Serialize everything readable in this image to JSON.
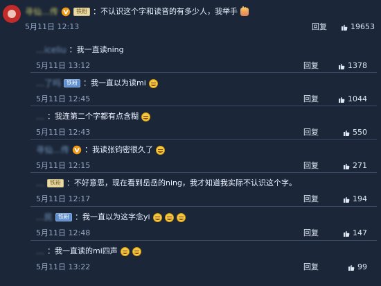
{
  "top_comment": {
    "username": "寻仙…传",
    "fan_label": "铁粉",
    "text": "：不认识这个字和读音的有多少人，我举手",
    "date": "5月11日 12:13",
    "reply_label": "回复",
    "likes": "19653"
  },
  "replies": [
    {
      "username": "…iceliu",
      "fan_label": "",
      "text": "：我一直读ning",
      "date": "5月11日 13:12",
      "reply_label": "回复",
      "likes": "1378",
      "emoji_count": 0
    },
    {
      "username": "…了吗",
      "fan_label": "铁粉",
      "text": "：我一直以为读mi",
      "date": "5月11日 12:45",
      "reply_label": "回复",
      "likes": "1044",
      "emoji_count": 1
    },
    {
      "username": "…",
      "fan_label": "",
      "text": "：我连第二个字都有点含糊",
      "date": "5月11日 12:43",
      "reply_label": "回复",
      "likes": "550",
      "emoji_count": 1
    },
    {
      "username": "寻仙…传",
      "fan_label": "",
      "text": "：我读张钧密很久了",
      "date": "5月11日 12:15",
      "reply_label": "回复",
      "likes": "271",
      "emoji_count": 1
    },
    {
      "username": "…",
      "fan_label": "铁粉",
      "text": "：不好意思，现在看到岳岳的ning，我才知道我实际不认识这个字。",
      "date": "5月11日 12:17",
      "reply_label": "回复",
      "likes": "194",
      "emoji_count": 0
    },
    {
      "username": "…民",
      "fan_label": "铁粉",
      "text": "：我一直以为这字念yi",
      "date": "5月11日 12:48",
      "reply_label": "回复",
      "likes": "147",
      "emoji_count": 3
    },
    {
      "username": "…",
      "fan_label": "",
      "text": "：我一直读的mi四声",
      "date": "5月11日 13:22",
      "reply_label": "回复",
      "likes": "99",
      "emoji_count": 2
    }
  ],
  "icons": {
    "avatar": "avatar",
    "vip": "vip-badge-icon",
    "thumb": "thumbs-up-icon",
    "emoji": "laughing-tears-emoji-icon",
    "hand": "raised-hand-emoji-icon"
  },
  "colors": {
    "background": "#1b2638",
    "badge_blue": "#5d8ed0",
    "badge_gold": "#e7dca6",
    "username_blue": "#7ea1c8",
    "username_gold": "#d7d76e"
  }
}
